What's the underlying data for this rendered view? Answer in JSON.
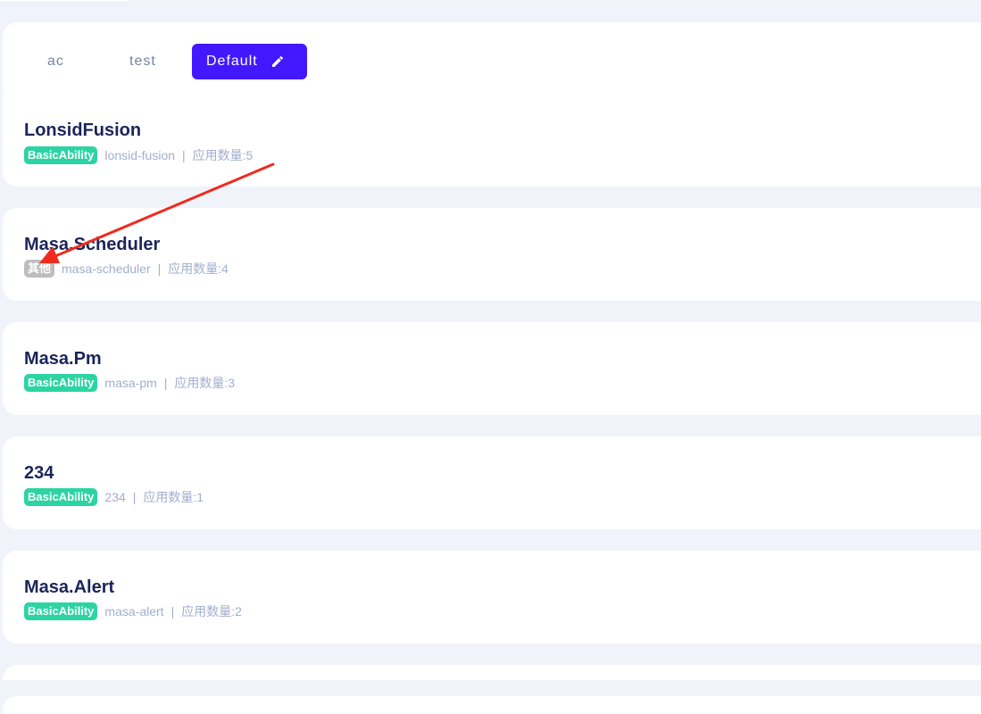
{
  "tabs": [
    {
      "label": "ac"
    },
    {
      "label": "test"
    },
    {
      "label": "Default"
    }
  ],
  "apps": [
    {
      "title": "LonsidFusion",
      "tag": "BasicAbility",
      "identifier": "lonsid-fusion",
      "separator": "|",
      "count_text": "应用数量:5"
    },
    {
      "title": "Masa.Scheduler",
      "tag": "其他",
      "identifier": "masa-scheduler",
      "separator": "|",
      "count_text": "应用数量:4"
    },
    {
      "title": "Masa.Pm",
      "tag": "BasicAbility",
      "identifier": "masa-pm",
      "separator": "|",
      "count_text": "应用数量:3"
    },
    {
      "title": "234",
      "tag": "BasicAbility",
      "identifier": "234",
      "separator": "|",
      "count_text": "应用数量:1"
    },
    {
      "title": "Masa.Alert",
      "tag": "BasicAbility",
      "identifier": "masa-alert",
      "separator": "|",
      "count_text": "应用数量:2"
    }
  ],
  "colors": {
    "accent": "#4318FF",
    "tag_basic": "#2CD4A4",
    "tag_other": "#BDBDBD",
    "annotation_arrow": "#F02A1E",
    "background": "#F0F3FA"
  },
  "icons": {
    "edit": "pencil-icon"
  }
}
